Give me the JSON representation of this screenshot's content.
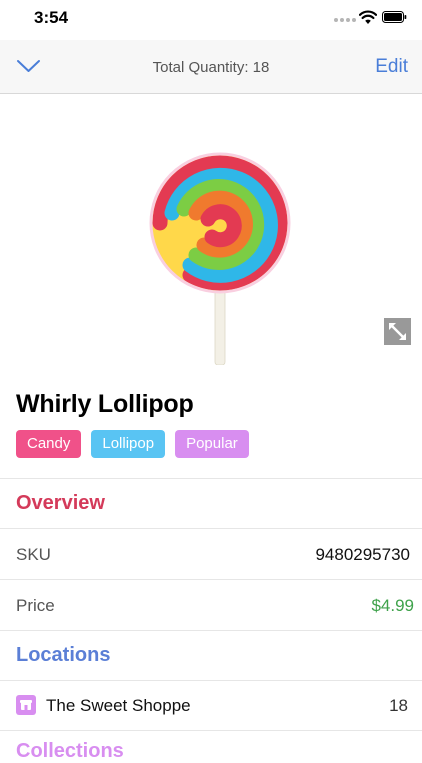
{
  "status_bar": {
    "time": "3:54"
  },
  "nav": {
    "title": "Total Quantity: 18",
    "edit_label": "Edit"
  },
  "product": {
    "name": "Whirly Lollipop",
    "tags": [
      "Candy",
      "Lollipop",
      "Popular"
    ]
  },
  "overview": {
    "header": "Overview",
    "sku_label": "SKU",
    "sku_value": "9480295730",
    "price_label": "Price",
    "price_value": "$4.99"
  },
  "locations": {
    "header": "Locations",
    "items": [
      {
        "name": "The Sweet Shoppe",
        "quantity": "18"
      }
    ]
  },
  "collections": {
    "header": "Collections"
  },
  "colors": {
    "accent_blue": "#4a7ed8",
    "overview_red": "#d43a5a",
    "locations_blue": "#5b7fd6",
    "price_green": "#3fa24b",
    "tag_candy": "#f05189",
    "tag_lollipop": "#59c4f3",
    "tag_popular": "#d88ef0"
  }
}
